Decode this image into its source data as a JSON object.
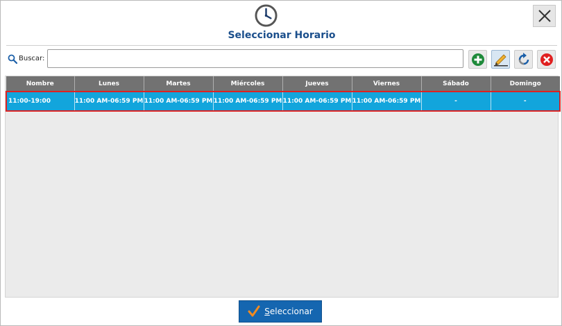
{
  "dialog": {
    "title": "Seleccionar Horario",
    "icon": "clock-icon",
    "close_icon": "close-icon"
  },
  "search": {
    "label": "Buscar:",
    "value": "",
    "placeholder": ""
  },
  "toolbar": {
    "buttons": [
      {
        "name": "add",
        "icon": "add-icon",
        "color": "#1e8a3a"
      },
      {
        "name": "edit",
        "icon": "pencil-icon",
        "color": "#e0a020"
      },
      {
        "name": "refresh",
        "icon": "refresh-icon",
        "color": "#1b5fa8"
      },
      {
        "name": "delete",
        "icon": "delete-icon",
        "color": "#e02020"
      }
    ]
  },
  "table": {
    "columns": [
      "Nombre",
      "Lunes",
      "Martes",
      "Miércoles",
      "Jueves",
      "Viernes",
      "Sábado",
      "Domingo"
    ],
    "rows": [
      {
        "selected": true,
        "cells": [
          "11:00-19:00",
          "11:00 AM-06:59 PM",
          "11:00 AM-06:59 PM",
          "11:00 AM-06:59 PM",
          "11:00 AM-06:59 PM",
          "11:00 AM-06:59 PM",
          "-",
          "-"
        ]
      }
    ]
  },
  "footer": {
    "select_label": "Seleccionar",
    "select_icon": "checkmark-icon"
  },
  "colors": {
    "title": "#1b4f8c",
    "header_bg": "#727272",
    "selected_row_bg": "#12a5dc",
    "selected_row_border": "#dd2222",
    "primary_button": "#1566b0"
  }
}
